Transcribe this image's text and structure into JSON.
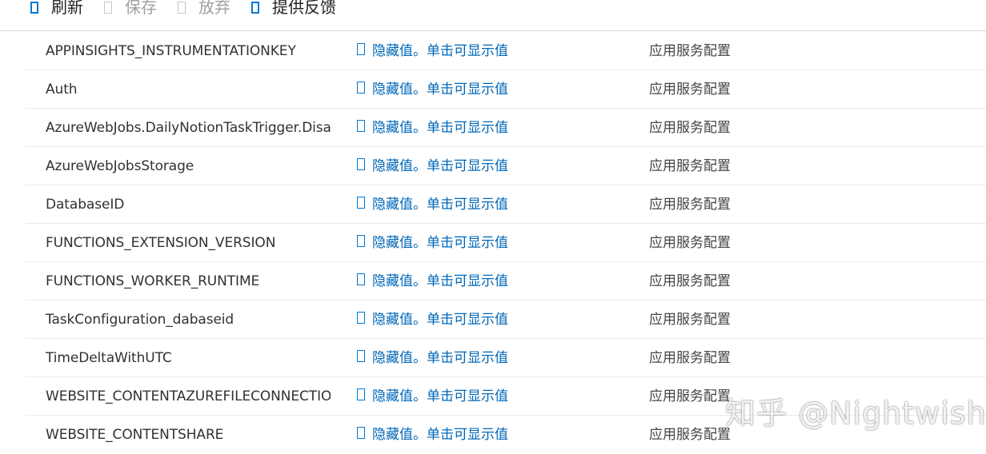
{
  "toolbar": {
    "refresh_label": "刷新",
    "save_label": "保存",
    "discard_label": "放弃",
    "feedback_label": "提供反馈"
  },
  "settings": {
    "hidden_value_text": "隐藏值。单击可显示值",
    "rows": [
      {
        "name": "APPINSIGHTS_INSTRUMENTATIONKEY",
        "value": "隐藏值。单击可显示值",
        "source": "应用服务配置"
      },
      {
        "name": "Auth",
        "value": "隐藏值。单击可显示值",
        "source": "应用服务配置"
      },
      {
        "name": "AzureWebJobs.DailyNotionTaskTrigger.Disabl",
        "value": "隐藏值。单击可显示值",
        "source": "应用服务配置"
      },
      {
        "name": "AzureWebJobsStorage",
        "value": "隐藏值。单击可显示值",
        "source": "应用服务配置"
      },
      {
        "name": "DatabaseID",
        "value": "隐藏值。单击可显示值",
        "source": "应用服务配置"
      },
      {
        "name": "FUNCTIONS_EXTENSION_VERSION",
        "value": "隐藏值。单击可显示值",
        "source": "应用服务配置"
      },
      {
        "name": "FUNCTIONS_WORKER_RUNTIME",
        "value": "隐藏值。单击可显示值",
        "source": "应用服务配置"
      },
      {
        "name": "TaskConfiguration_dabaseid",
        "value": "隐藏值。单击可显示值",
        "source": "应用服务配置"
      },
      {
        "name": "TimeDeltaWithUTC",
        "value": "隐藏值。单击可显示值",
        "source": "应用服务配置"
      },
      {
        "name": "WEBSITE_CONTENTAZUREFILECONNECTIONS",
        "value": "隐藏值。单击可显示值",
        "source": "应用服务配置"
      },
      {
        "name": "WEBSITE_CONTENTSHARE",
        "value": "隐藏值。单击可显示值",
        "source": "应用服务配置"
      }
    ]
  },
  "watermark": "知乎 @Nightwish",
  "colors": {
    "accent": "#0078d4",
    "link": "#0067b8",
    "text": "#323130",
    "disabled": "#a0a0a0",
    "divider": "#eaeaea"
  }
}
